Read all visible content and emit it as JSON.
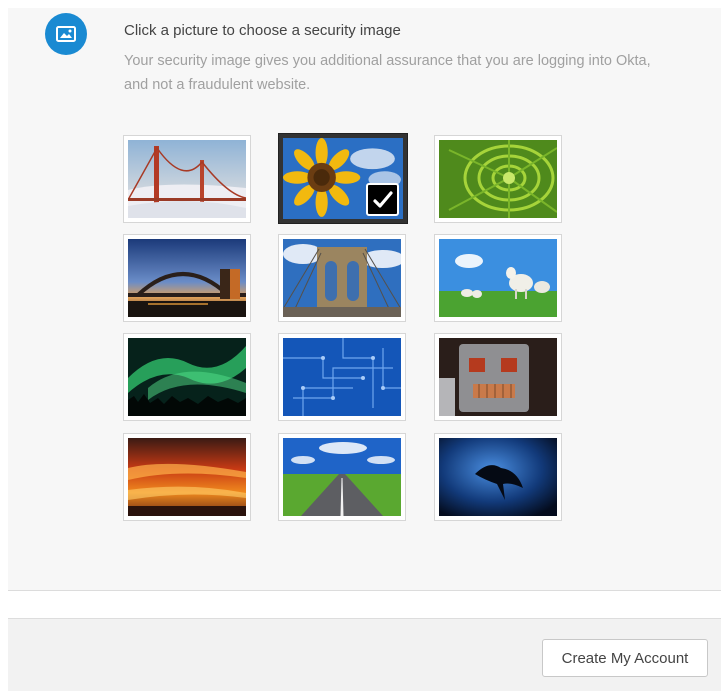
{
  "header": {
    "icon": "picture-icon",
    "title": "Click a picture to choose a security image",
    "description": "Your security image gives you additional assurance that you are logging into Okta, and not a fraudulent website."
  },
  "security_images": {
    "selected_index": 1,
    "images": [
      {
        "name": "golden-gate-bridge"
      },
      {
        "name": "sunflower"
      },
      {
        "name": "succulent-plant"
      },
      {
        "name": "harbour-bridge-sunset"
      },
      {
        "name": "brooklyn-bridge"
      },
      {
        "name": "lambs-on-grass"
      },
      {
        "name": "aurora-borealis"
      },
      {
        "name": "circuit-board"
      },
      {
        "name": "toy-robot"
      },
      {
        "name": "fiery-sunset-clouds"
      },
      {
        "name": "open-road"
      },
      {
        "name": "manta-ray"
      }
    ]
  },
  "footer": {
    "submit_label": "Create My Account"
  },
  "colors": {
    "accent": "#1a8ad2",
    "selected_border": "#333333"
  }
}
